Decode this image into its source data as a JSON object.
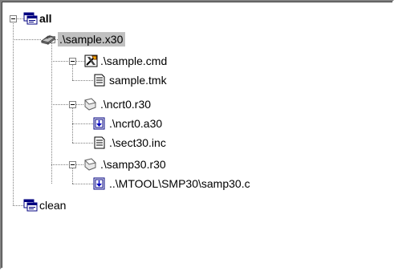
{
  "tree": {
    "nodes": [
      {
        "id": "all",
        "label": "all",
        "icon": "workspace-icon",
        "bold": true,
        "expanded": true
      },
      {
        "id": "sample-x30",
        "label": ".\\sample.x30",
        "icon": "chip-icon",
        "selected": true,
        "expanded": true
      },
      {
        "id": "sample-cmd",
        "label": ".\\sample.cmd",
        "icon": "tools-icon",
        "expanded": true
      },
      {
        "id": "sample-tmk",
        "label": "sample.tmk",
        "icon": "document-icon"
      },
      {
        "id": "ncrt0-r30",
        "label": ".\\ncrt0.r30",
        "icon": "object-module-icon",
        "expanded": true
      },
      {
        "id": "ncrt0-a30",
        "label": ".\\ncrt0.a30",
        "icon": "source-file-icon"
      },
      {
        "id": "sect30-inc",
        "label": ".\\sect30.inc",
        "icon": "document-icon"
      },
      {
        "id": "samp30-r30",
        "label": ".\\samp30.r30",
        "icon": "object-module-icon",
        "expanded": true
      },
      {
        "id": "samp30-c",
        "label": "..\\MTOOL\\SMP30\\samp30.c",
        "icon": "source-file-icon"
      },
      {
        "id": "clean",
        "label": "clean",
        "icon": "workspace-icon"
      }
    ]
  }
}
